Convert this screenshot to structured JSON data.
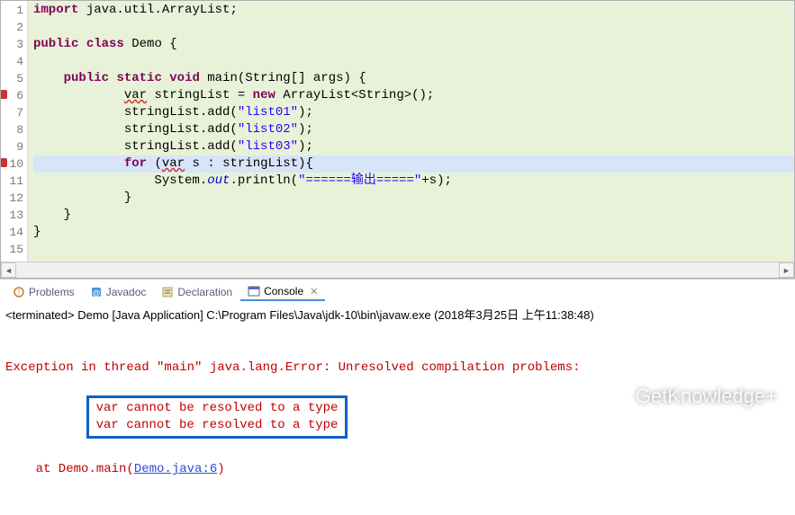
{
  "code": {
    "lines": [
      {
        "n": 1,
        "err": false,
        "hl": false,
        "tokens": [
          [
            "kw",
            "import"
          ],
          [
            "",
            " java.util.ArrayList;"
          ]
        ]
      },
      {
        "n": 2,
        "err": false,
        "hl": false,
        "tokens": [
          [
            "",
            ""
          ]
        ]
      },
      {
        "n": 3,
        "err": false,
        "hl": false,
        "tokens": [
          [
            "kw",
            "public"
          ],
          [
            "",
            " "
          ],
          [
            "kw",
            "class"
          ],
          [
            "",
            " Demo {"
          ]
        ]
      },
      {
        "n": 4,
        "err": false,
        "hl": false,
        "tokens": [
          [
            "",
            ""
          ]
        ]
      },
      {
        "n": 5,
        "err": false,
        "hl": false,
        "tokens": [
          [
            "",
            "    "
          ],
          [
            "kw",
            "public"
          ],
          [
            "",
            " "
          ],
          [
            "kw",
            "static"
          ],
          [
            "",
            " "
          ],
          [
            "kw",
            "void"
          ],
          [
            "",
            " main(String[] args) {"
          ]
        ]
      },
      {
        "n": 6,
        "err": true,
        "hl": false,
        "tokens": [
          [
            "",
            "            "
          ],
          [
            "squiggle",
            "var"
          ],
          [
            "",
            " stringList = "
          ],
          [
            "kw",
            "new"
          ],
          [
            "",
            " ArrayList<String>();"
          ]
        ]
      },
      {
        "n": 7,
        "err": false,
        "hl": false,
        "tokens": [
          [
            "",
            "            stringList.add("
          ],
          [
            "str",
            "\"list01\""
          ],
          [
            "",
            ");"
          ]
        ]
      },
      {
        "n": 8,
        "err": false,
        "hl": false,
        "tokens": [
          [
            "",
            "            stringList.add("
          ],
          [
            "str",
            "\"list02\""
          ],
          [
            "",
            ");"
          ]
        ]
      },
      {
        "n": 9,
        "err": false,
        "hl": false,
        "tokens": [
          [
            "",
            "            stringList.add("
          ],
          [
            "str",
            "\"list03\""
          ],
          [
            "",
            ");"
          ]
        ]
      },
      {
        "n": 10,
        "err": true,
        "hl": true,
        "tokens": [
          [
            "",
            "            "
          ],
          [
            "kw",
            "for"
          ],
          [
            "",
            " ("
          ],
          [
            "squiggle",
            "var"
          ],
          [
            "",
            " s : stringList){"
          ]
        ]
      },
      {
        "n": 11,
        "err": false,
        "hl": false,
        "tokens": [
          [
            "",
            "                System."
          ],
          [
            "field",
            "out"
          ],
          [
            "",
            ".println("
          ],
          [
            "str",
            "\"======输出=====\""
          ],
          [
            "",
            "+s);"
          ]
        ]
      },
      {
        "n": 12,
        "err": false,
        "hl": false,
        "tokens": [
          [
            "",
            "            }"
          ]
        ]
      },
      {
        "n": 13,
        "err": false,
        "hl": false,
        "tokens": [
          [
            "",
            "    }"
          ]
        ]
      },
      {
        "n": 14,
        "err": false,
        "hl": false,
        "tokens": [
          [
            "",
            "}"
          ]
        ]
      },
      {
        "n": 15,
        "err": false,
        "hl": false,
        "tokens": [
          [
            "",
            ""
          ]
        ]
      }
    ]
  },
  "tabs": {
    "problems": "Problems",
    "javadoc": "Javadoc",
    "declaration": "Declaration",
    "console": "Console"
  },
  "console": {
    "header": "<terminated> Demo [Java Application] C:\\Program Files\\Java\\jdk-10\\bin\\javaw.exe (2018年3月25日 上午11:38:48)",
    "exception_line": "Exception in thread \"main\" java.lang.Error: Unresolved compilation problems:",
    "boxed_lines": [
      "var cannot be resolved to a type",
      "var cannot be resolved to a type"
    ],
    "at_prefix": "    at Demo.main(",
    "at_link": "Demo.java:6",
    "at_suffix": ")"
  },
  "watermark": "GetKnowledge+"
}
